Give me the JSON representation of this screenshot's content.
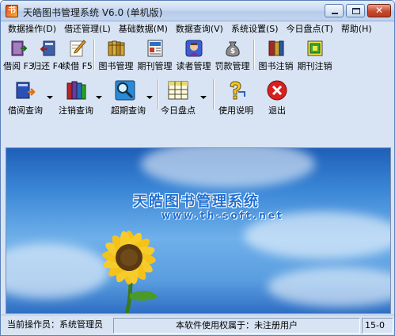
{
  "window": {
    "title": "天皓图书管理系统 V6.0 (单机版)",
    "app_icon_glyph": "书",
    "close_glyph": "✕"
  },
  "menu": [
    "数据操作(D)",
    "借还管理(L)",
    "基础数据(M)",
    "数据查询(V)",
    "系统设置(S)",
    "今日盘点(T)",
    "帮助(H)"
  ],
  "toolbar1": [
    {
      "label": "借阅 F3",
      "icon": "borrow-book-icon"
    },
    {
      "label": "归还 F4",
      "icon": "return-book-icon"
    },
    {
      "label": "续借 F5",
      "icon": "renew-pencil-icon"
    },
    {
      "label": "图书管理",
      "icon": "books-shelf-icon"
    },
    {
      "label": "期刊管理",
      "icon": "periodical-icon"
    },
    {
      "label": "读者管理",
      "icon": "reader-user-icon"
    },
    {
      "label": "罚款管理",
      "icon": "money-bag-icon"
    },
    {
      "label": "图书注销",
      "icon": "book-cancel-icon"
    },
    {
      "label": "期刊注销",
      "icon": "periodical-cancel-icon"
    }
  ],
  "toolbar2": [
    {
      "label": "借阅查询",
      "icon": "borrow-query-book-icon",
      "dropdown": true
    },
    {
      "label": "注销查询",
      "icon": "cancel-query-books-icon",
      "dropdown": true
    },
    {
      "label": "超期查询",
      "icon": "overdue-magnifier-icon",
      "dropdown": true
    },
    {
      "label": "今日盘点",
      "icon": "inventory-spreadsheet-icon",
      "dropdown": true
    },
    {
      "label": "使用说明",
      "icon": "help-question-icon",
      "dropdown": false
    },
    {
      "label": "退出",
      "icon": "exit-red-x-icon",
      "dropdown": false
    }
  ],
  "banner": {
    "title": "天皓图书管理系统",
    "url": "www.th-soft.net"
  },
  "statusbar": {
    "operator": "当前操作员：系统管理员",
    "license": "本软件使用权属于：未注册用户",
    "date_fragment": "15-0"
  },
  "colors": {
    "window_bg": "#d8e4f3",
    "title_gradient_top": "#e3ecf8",
    "banner_text": "#1f6fd2",
    "sky_top": "#1e5fb8",
    "sunflower_petal": "#f5c21a",
    "sunflower_center": "#5a3a12"
  }
}
